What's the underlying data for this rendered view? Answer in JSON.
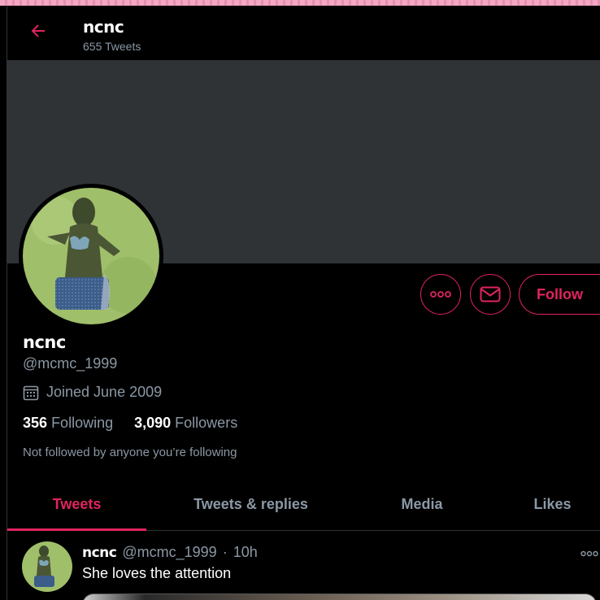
{
  "header": {
    "name": "ncnc",
    "tweet_count": "655 Tweets"
  },
  "profile": {
    "name": "ncnc",
    "handle": "@mcmc_1999",
    "joined": "Joined June 2009",
    "following_count": "356",
    "following_label": "Following",
    "followers_count": "3,090",
    "followers_label": "Followers",
    "not_followed": "Not followed by anyone you’re following"
  },
  "actions": {
    "follow_label": "Follow"
  },
  "tabs": [
    {
      "label": "Tweets",
      "active": true
    },
    {
      "label": "Tweets & replies"
    },
    {
      "label": "Media"
    },
    {
      "label": "Likes"
    }
  ],
  "tweet": {
    "name": "ncnc",
    "handle": "@mcmc_1999",
    "separator": "·",
    "time": "10h",
    "text": "She loves the attention"
  },
  "colors": {
    "accent": "#e0245e",
    "banner": "#2f3336",
    "muted": "#8b98a5"
  },
  "icons": [
    "back-arrow-icon",
    "more-icon",
    "mail-icon",
    "calendar-icon",
    "more-horizontal-icon"
  ]
}
